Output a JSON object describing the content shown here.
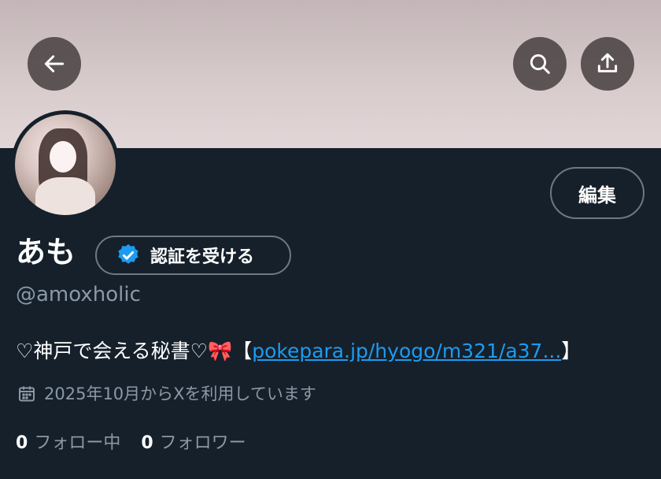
{
  "header": {
    "back_icon": "arrow-left-icon",
    "search_icon": "search-icon",
    "share_icon": "share-icon"
  },
  "profile": {
    "display_name": "あも",
    "verify_label": "認証を受ける",
    "handle": "@amoxholic",
    "edit_label": "編集",
    "bio_text": "♡神戸で会える秘書♡🎀【",
    "bio_link": "pokepara.jp/hyogo/m321/a37...",
    "bio_end": "】",
    "joined": "2025年10月からXを利用しています",
    "following_count": "0",
    "following_label": "フォロー中",
    "followers_count": "0",
    "followers_label": "フォロワー"
  },
  "colors": {
    "background": "#15202b",
    "link": "#1d9bf0",
    "secondary_text": "#8b98a5",
    "verified_badge": "#1d9bf0"
  }
}
